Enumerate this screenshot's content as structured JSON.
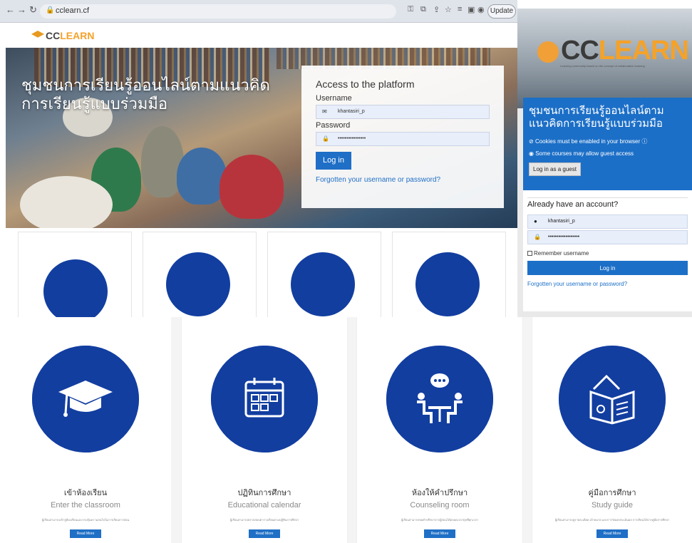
{
  "browser": {
    "url": "cclearn.cf",
    "update_label": "Update"
  },
  "header": {
    "logo_cc": "CC",
    "logo_learn": "LEARN"
  },
  "hero": {
    "title": "ชุมชนการเรียนรู้ออนไลน์ตามแนวคิดการเรียนรู้แบบร่วมมือ"
  },
  "login": {
    "title": "Access to the platform",
    "username_label": "Username",
    "username_value": "khantasiri_p",
    "password_label": "Password",
    "password_value": "••••••••••••••••",
    "login_button": "Log in",
    "forgot_link": "Forgotten your username or password?"
  },
  "mobile": {
    "logo_cc": "CC",
    "logo_learn": "LEARN",
    "tagline": "Learning community based on the concept of collaborative learning",
    "title": "ชุมชนการเรียนรู้ออนไลน์ตามแนวคิดการเรียนรู้แบบร่วมมือ",
    "cookies_note": "Cookies must be enabled in your browser",
    "guest_note": "Some courses may allow guest access",
    "guest_button": "Log in as a guest",
    "have_account": "Already have an account?",
    "username_value": "khantasiri_p",
    "password_value": "••••••••••••••••••",
    "remember": "Remember username",
    "login_button": "Log in",
    "forgot_link": "Forgotten your username or password?"
  },
  "cards": [
    {
      "thai": "เข้าห้องเรียน",
      "en": "Enter the classroom",
      "desc": "ผู้เรียนสามารถเข้าสู่ห้องเรียนและกระตุ้นความสนใจในการเรียนการสอน",
      "button": "Read More",
      "icon": "graduation-cap-icon"
    },
    {
      "thai": "ปฏิทินการศึกษา",
      "en": "Educational calendar",
      "desc": "ผู้เรียนสามารถตรวจสอบตารางเรียนตามปฏิทินการศึกษา",
      "button": "Read More",
      "icon": "calendar-icon"
    },
    {
      "thai": "ห้องให้คำปรึกษา",
      "en": "Counseling room",
      "desc": "ผู้เรียนสามารถขอคำปรึกษาจากผู้สอนได้ตลอดเวลาทุกที่ทุกเวลา",
      "button": "Read More",
      "icon": "counseling-icon"
    },
    {
      "thai": "คู่มือการศึกษา",
      "en": "Study guide",
      "desc": "ผู้เรียนสามารถดูรายละเอียด เป้าหมาย และการวัดผลประเมินผล การเรียนได้จากคู่มือการศึกษา",
      "button": "Read More",
      "icon": "study-guide-icon"
    }
  ],
  "colors": {
    "brand_blue": "#123ea0",
    "link_blue": "#1f6fc6",
    "logo_orange": "#f4a229"
  }
}
